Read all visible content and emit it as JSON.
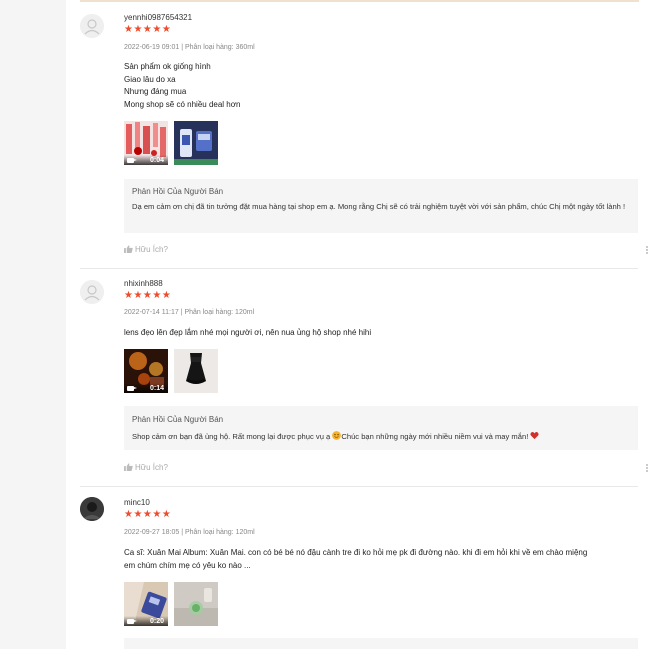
{
  "reviews": [
    {
      "username": "yennhi0987654321",
      "stars": "★★★★★",
      "meta": "2022-06-19 09:01 | Phân loại hàng: 360ml",
      "lines": [
        "Sản phẩm ok giống hình",
        "Giao lâu do xa",
        "Nhưng đáng mua",
        "Mong shop sẽ có nhiều deal hơn"
      ],
      "media": [
        {
          "type": "video",
          "duration": "0:04"
        },
        {
          "type": "image"
        }
      ],
      "reply_title": "Phản Hồi Của Người Bán",
      "reply_text": "Dạ em cảm ơn chị đã tin tưởng đặt mua hàng tại shop em ạ. Mong rằng Chị sẽ có trải nghiệm tuyệt vời với sản phẩm, chúc Chị một ngày tốt lành !",
      "helpful": "Hữu Ích?"
    },
    {
      "username": "nhixinh888",
      "stars": "★★★★★",
      "meta": "2022-07-14 11:17 | Phân loại hàng: 120ml",
      "lines": [
        "lens đẹo lên đẹp lắm nhé mọi người ơi, nên nua ủng hộ shop nhé hihi"
      ],
      "media": [
        {
          "type": "video",
          "duration": "0:14"
        },
        {
          "type": "image"
        }
      ],
      "reply_title": "Phản Hồi Của Người Bán",
      "reply_text_before": "Shop cảm ơn bạn đã ủng hộ. Rất mong lại được phục vụ ạ ",
      "reply_text_after": "Chúc bạn những ngày mới nhiều niềm vui và may mắn! ",
      "helpful": "Hữu Ích?"
    },
    {
      "username": "minc10",
      "stars": "★★★★★",
      "meta": "2022-09-27 18:05 | Phân loại hàng: 120ml",
      "lines": [
        "Ca sĩ: Xuân Mai Album: Xuân Mai. con có bé bé nó đậu cành tre đi ko hỏi mẹ pk đi đường nào. khi đi em hỏi khi về em chào miệng",
        "em chúm chím mẹ có yêu ko nào ..."
      ],
      "media": [
        {
          "type": "video",
          "duration": "0:20"
        },
        {
          "type": "image"
        }
      ]
    }
  ],
  "colors": {
    "star": "#ee4d2d",
    "reply_bg": "#f5f5f5",
    "page_bg": "#f5f5f5"
  },
  "icons": [
    "user-placeholder-icon",
    "star-icon",
    "video-camera-icon",
    "thumbs-up-icon",
    "more-vertical-icon",
    "smile-emoji-icon",
    "heart-emoji-icon"
  ]
}
